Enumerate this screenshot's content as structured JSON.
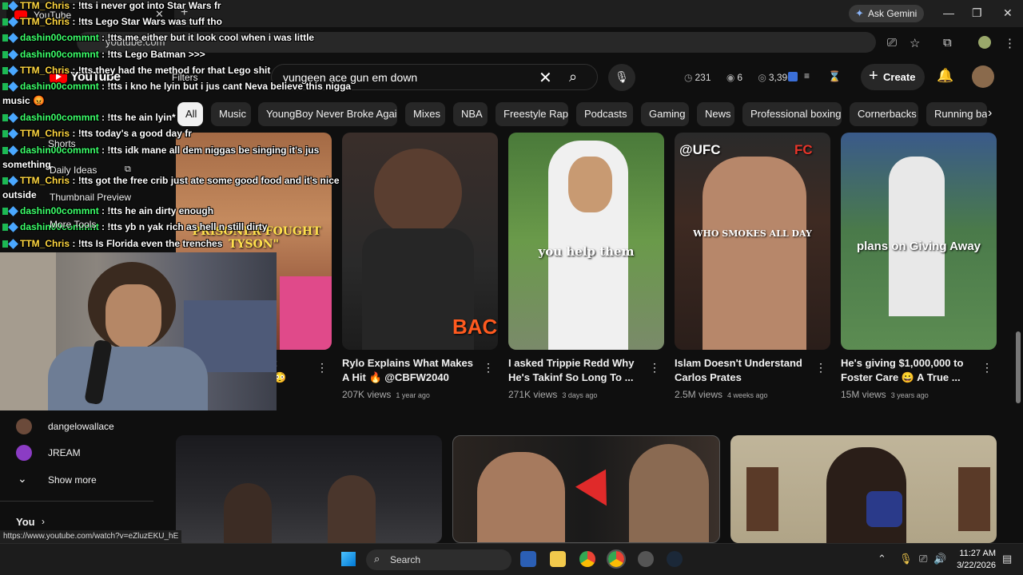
{
  "browser": {
    "tab_title": "YouTube",
    "tab_close": "✕",
    "new_tab": "+",
    "ask_gemini": "Ask Gemini",
    "address": "youtube.com",
    "win_min": "—",
    "win_max": "❐",
    "win_close": "✕"
  },
  "yt": {
    "logo": "YouTube",
    "search_value": "yungeen ace gun em down",
    "clear": "✕",
    "search_icon": "⌕",
    "mic_icon": "🎙",
    "stats": {
      "a": "231",
      "b": "6",
      "c": "3,396"
    },
    "create": "Create",
    "bell": "🔔"
  },
  "chips": [
    "All",
    "Music",
    "YoungBoy Never Broke Again",
    "Mixes",
    "NBA",
    "Freestyle Rap",
    "Podcasts",
    "Gaming",
    "News",
    "Professional boxing",
    "Cornerbacks",
    "Running ba"
  ],
  "chip_next": "›",
  "chat": [
    {
      "user": "TTM_Chris",
      "msg": "!tts i never got into Star Wars fr"
    },
    {
      "user": "TTM_Chris",
      "msg": "!tts Lego Star Wars was tuff tho"
    },
    {
      "user": "dashin00commnt",
      "msg": "!tts me either but it look cool when i was little"
    },
    {
      "user": "dashin00commnt",
      "msg": "!tts Lego Batman >>>"
    },
    {
      "user": "TTM_Chris",
      "msg": "!tts they had the method for that Lego shit"
    },
    {
      "user": "dashin00commnt",
      "msg": "!tts i kno he lyin but i jus cant Neva believe this nigga"
    },
    {
      "user": "",
      "msg": "music 😡"
    },
    {
      "user": "dashin00commnt",
      "msg": "!tts he ain lyin*"
    },
    {
      "user": "TTM_Chris",
      "msg": "!tts today's a good day fr"
    },
    {
      "user": "dashin00commnt",
      "msg": "!tts idk mane all dem niggas be singing it's jus"
    },
    {
      "user": "",
      "msg": "something."
    },
    {
      "user": "TTM_Chris",
      "msg": "!tts got the free crib just ate some good food and it's nice"
    },
    {
      "user": "",
      "msg": "outside"
    },
    {
      "user": "dashin00commnt",
      "msg": "!tts he ain dirty enough"
    },
    {
      "user": "dashin00commnt",
      "msg": "!tts yb n yak rich as hell n still dirty"
    },
    {
      "user": "TTM_Chris",
      "msg": "!tts Is Florida even the trenches"
    }
  ],
  "overlay_menu": {
    "filters": "Filters",
    "shorts": "Shorts",
    "daily": "Daily Ideas",
    "thumbprev": "Thumbnail Preview",
    "moretools": "More Tools"
  },
  "sidebar": {
    "sub1": "dangelowallace",
    "sub2": "JREAM",
    "show_more": "Show more",
    "you": "You"
  },
  "videos": [
    {
      "thumb_text": "\"PRISONER FOUGHT TYSON\"",
      "title": "",
      "views": "",
      "age": ""
    },
    {
      "thumb_text": "BAC",
      "title": "Rylo Explains What Makes A Hit 🔥 @CBFW2040",
      "views": "207K views",
      "age": "1 year ago"
    },
    {
      "thumb_text": "you help them",
      "title": "I asked Trippie Redd Why He's Takinf So Long To ...",
      "views": "271K views",
      "age": "3 days ago"
    },
    {
      "thumb_text": "WHO SMOKES ALL DAY",
      "title": "Islam Doesn't Understand Carlos Prates",
      "views": "2.5M views",
      "age": "4 weeks ago"
    },
    {
      "thumb_text": "plans on Giving Away",
      "title": "He's giving $1,000,000 to Foster Care 😀 A True ...",
      "views": "15M views",
      "age": "3 years ago"
    }
  ],
  "thumb_labels": {
    "ufc": "@UFC",
    "fc": "FC"
  },
  "status_url": "https://www.youtube.com/watch?v=eZluzEKU_hE",
  "taskbar": {
    "search": "Search",
    "time": "11:27 AM",
    "date": "3/22/2026"
  },
  "colors": {
    "yt_red": "#ff0000",
    "chat_ttm": "#ffd740",
    "chat_dash": "#3cff6a"
  }
}
